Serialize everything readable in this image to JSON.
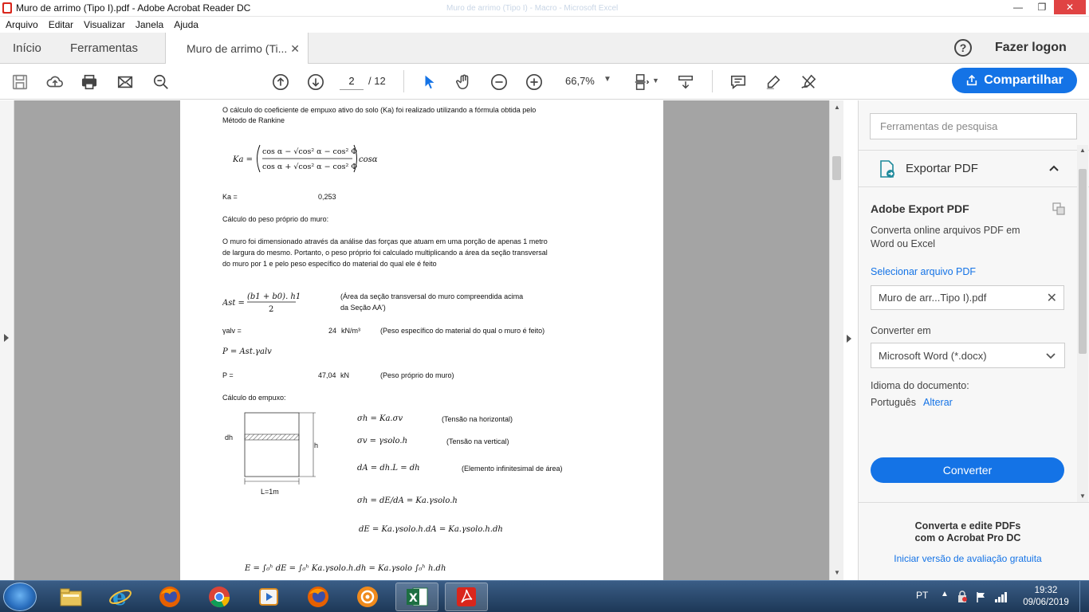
{
  "window": {
    "title": "Muro de arrimo (Tipo I).pdf - Adobe Acrobat Reader DC",
    "ghost_title": "Muro de arrimo (Tipo I) - Macro - Microsoft Excel"
  },
  "menu": [
    "Arquivo",
    "Editar",
    "Visualizar",
    "Janela",
    "Ajuda"
  ],
  "tabs": {
    "home": "Início",
    "tools": "Ferramentas",
    "doc": "Muro de arrimo (Ti...",
    "login": "Fazer logon"
  },
  "toolbar": {
    "page_current": "2",
    "page_total": "/ 12",
    "zoom": "66,7%",
    "share": "Compartilhar"
  },
  "document": {
    "p1_line1": "O cálculo do coeficiente de empuxo ativo do solo (Ka) foi realizado utilizando a fórmula obtida pelo",
    "p1_line2": "Método de Rankine",
    "ka_label": "Ka =",
    "ka_value": "0,253",
    "peso_heading": "Cálculo do peso próprio do muro:",
    "p2_line1": "O muro foi dimensionado através da análise das forças que atuam em uma porção de apenas 1 metro",
    "p2_line2": "de largura do mesmo. Portanto, o peso próprio foi calculado multiplicando a área da seção transversal",
    "p2_line3": "do muro por 1 e pelo peso específico do material do qual ele é feito",
    "ast_note_1": "(Área da seção transversal do muro compreendida acima",
    "ast_note_2": "da Seção AA')",
    "galv_label": "γalv =",
    "galv_value": "24",
    "galv_unit": "kN/m³",
    "galv_note": "(Peso específico do material do qual o muro é feito)",
    "p_formula": "P = Ast.γalv",
    "p_label": "P =",
    "p_value": "47,04",
    "p_unit": "kN",
    "p_note": "(Peso próprio do muro)",
    "empuxo_heading": "Cálculo do empuxo:",
    "fig_dh": "dh",
    "fig_h": "h",
    "fig_l": "L=1m",
    "eq1": "σh = Ka.σv",
    "eq1_note": "(Tensão na horizontal)",
    "eq2": "σv = γsolo.h",
    "eq2_note": "(Tensão na vertical)",
    "eq3": "dA = dh.L = dh",
    "eq3_note": "(Elemento infinitesimal de área)",
    "eq4": "σh = dE/dA = Ka.γsolo.h",
    "eq5": "dE = Ka.γsolo.h.dA = Ka.γsolo.h.dh",
    "eq6": "E = ∫₀ʰ dE = ∫₀ʰ Ka.γsolo.h.dh = Ka.γsolo ∫₀ʰ h.dh"
  },
  "right_panel": {
    "search_placeholder": "Ferramentas de pesquisa",
    "export_header": "Exportar PDF",
    "ae_title": "Adobe Export PDF",
    "ae_desc": "Converta online arquivos PDF em Word ou Excel",
    "select_link": "Selecionar arquivo PDF",
    "file_name": "Muro de arr...Tipo I).pdf",
    "convert_to_label": "Converter em",
    "format": "Microsoft Word (*.docx)",
    "lang_label": "Idioma do documento:",
    "lang_value": "Português",
    "lang_change": "Alterar",
    "convert_btn": "Converter",
    "pro_title_1": "Converta e edite PDFs",
    "pro_title_2": "com o Acrobat Pro DC",
    "pro_link": "Iniciar versão de avaliação gratuita"
  },
  "taskbar": {
    "lang": "PT",
    "time": "19:32",
    "date": "09/06/2019"
  },
  "colors": {
    "accent": "#1473e6",
    "acrobat_red": "#d9261c",
    "doc_bg": "#a4a4a4"
  }
}
